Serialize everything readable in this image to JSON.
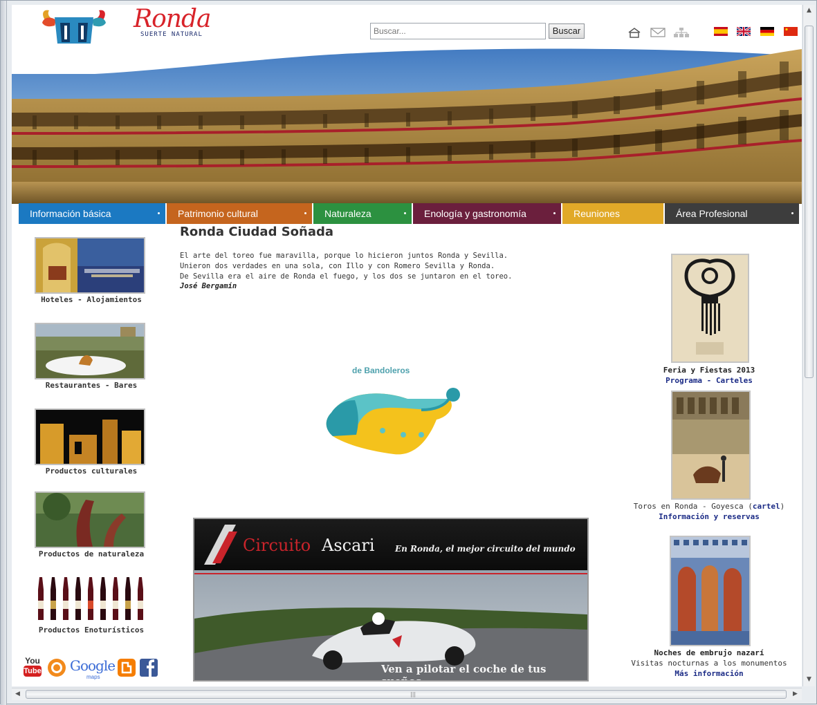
{
  "header": {
    "brand_name": "Ronda",
    "brand_tagline": "SUERTE NATURAL",
    "search_placeholder": "Buscar...",
    "search_button": "Buscar"
  },
  "nav": [
    {
      "label": "Información básica",
      "color": "#1b79c2"
    },
    {
      "label": "Patrimonio cultural",
      "color": "#c5651e"
    },
    {
      "label": "Naturaleza",
      "color": "#2c9140"
    },
    {
      "label": "Enología y gastronomía",
      "color": "#6b1f3d"
    },
    {
      "label": "Reuniones",
      "color": "#e1a928"
    },
    {
      "label": "Área Profesional",
      "color": "#3d3d3d"
    }
  ],
  "sidebar": [
    {
      "label": "Hoteles - Alojamientos"
    },
    {
      "label": "Restaurantes - Bares"
    },
    {
      "label": "Productos culturales"
    },
    {
      "label": "Productos de naturaleza"
    },
    {
      "label": "Productos Enoturísticos"
    }
  ],
  "main": {
    "title": "Ronda Ciudad Soñada",
    "quote_lines": [
      "El arte del toreo fue maravilla, porque lo hicieron juntos Ronda y Sevilla.",
      "Unieron dos verdades en una sola, con Illo y con Romero Sevilla y Ronda.",
      "De Sevilla era el aire de Ronda el fuego, y los dos se juntaron en el toreo."
    ],
    "quote_author": "José Bergamín",
    "band_text": "de Bandoleros"
  },
  "ad": {
    "brand_a": "Circuito",
    "brand_b": "Ascari",
    "tagline": "En Ronda, el mejor circuito del mundo",
    "cta": "Ven a pilotar el coche de tus sueños"
  },
  "right": {
    "feria_title": "Feria y Fiestas 2013",
    "feria_links": {
      "a": "Programa",
      "sep": " - ",
      "b": "Carteles"
    },
    "toros_text": "Toros en Ronda - Goyesca (",
    "toros_link": "cartel",
    "toros_close": ")",
    "toros_info": "Información y reservas",
    "noches_title": "Noches de embrujo nazarí",
    "noches_sub": "Visitas nocturnas a los monumentos",
    "noches_link": "Más información"
  },
  "social": {
    "youtube_top": "You",
    "youtube_bottom": "Tube",
    "google": "Google",
    "google_sub": "maps"
  }
}
